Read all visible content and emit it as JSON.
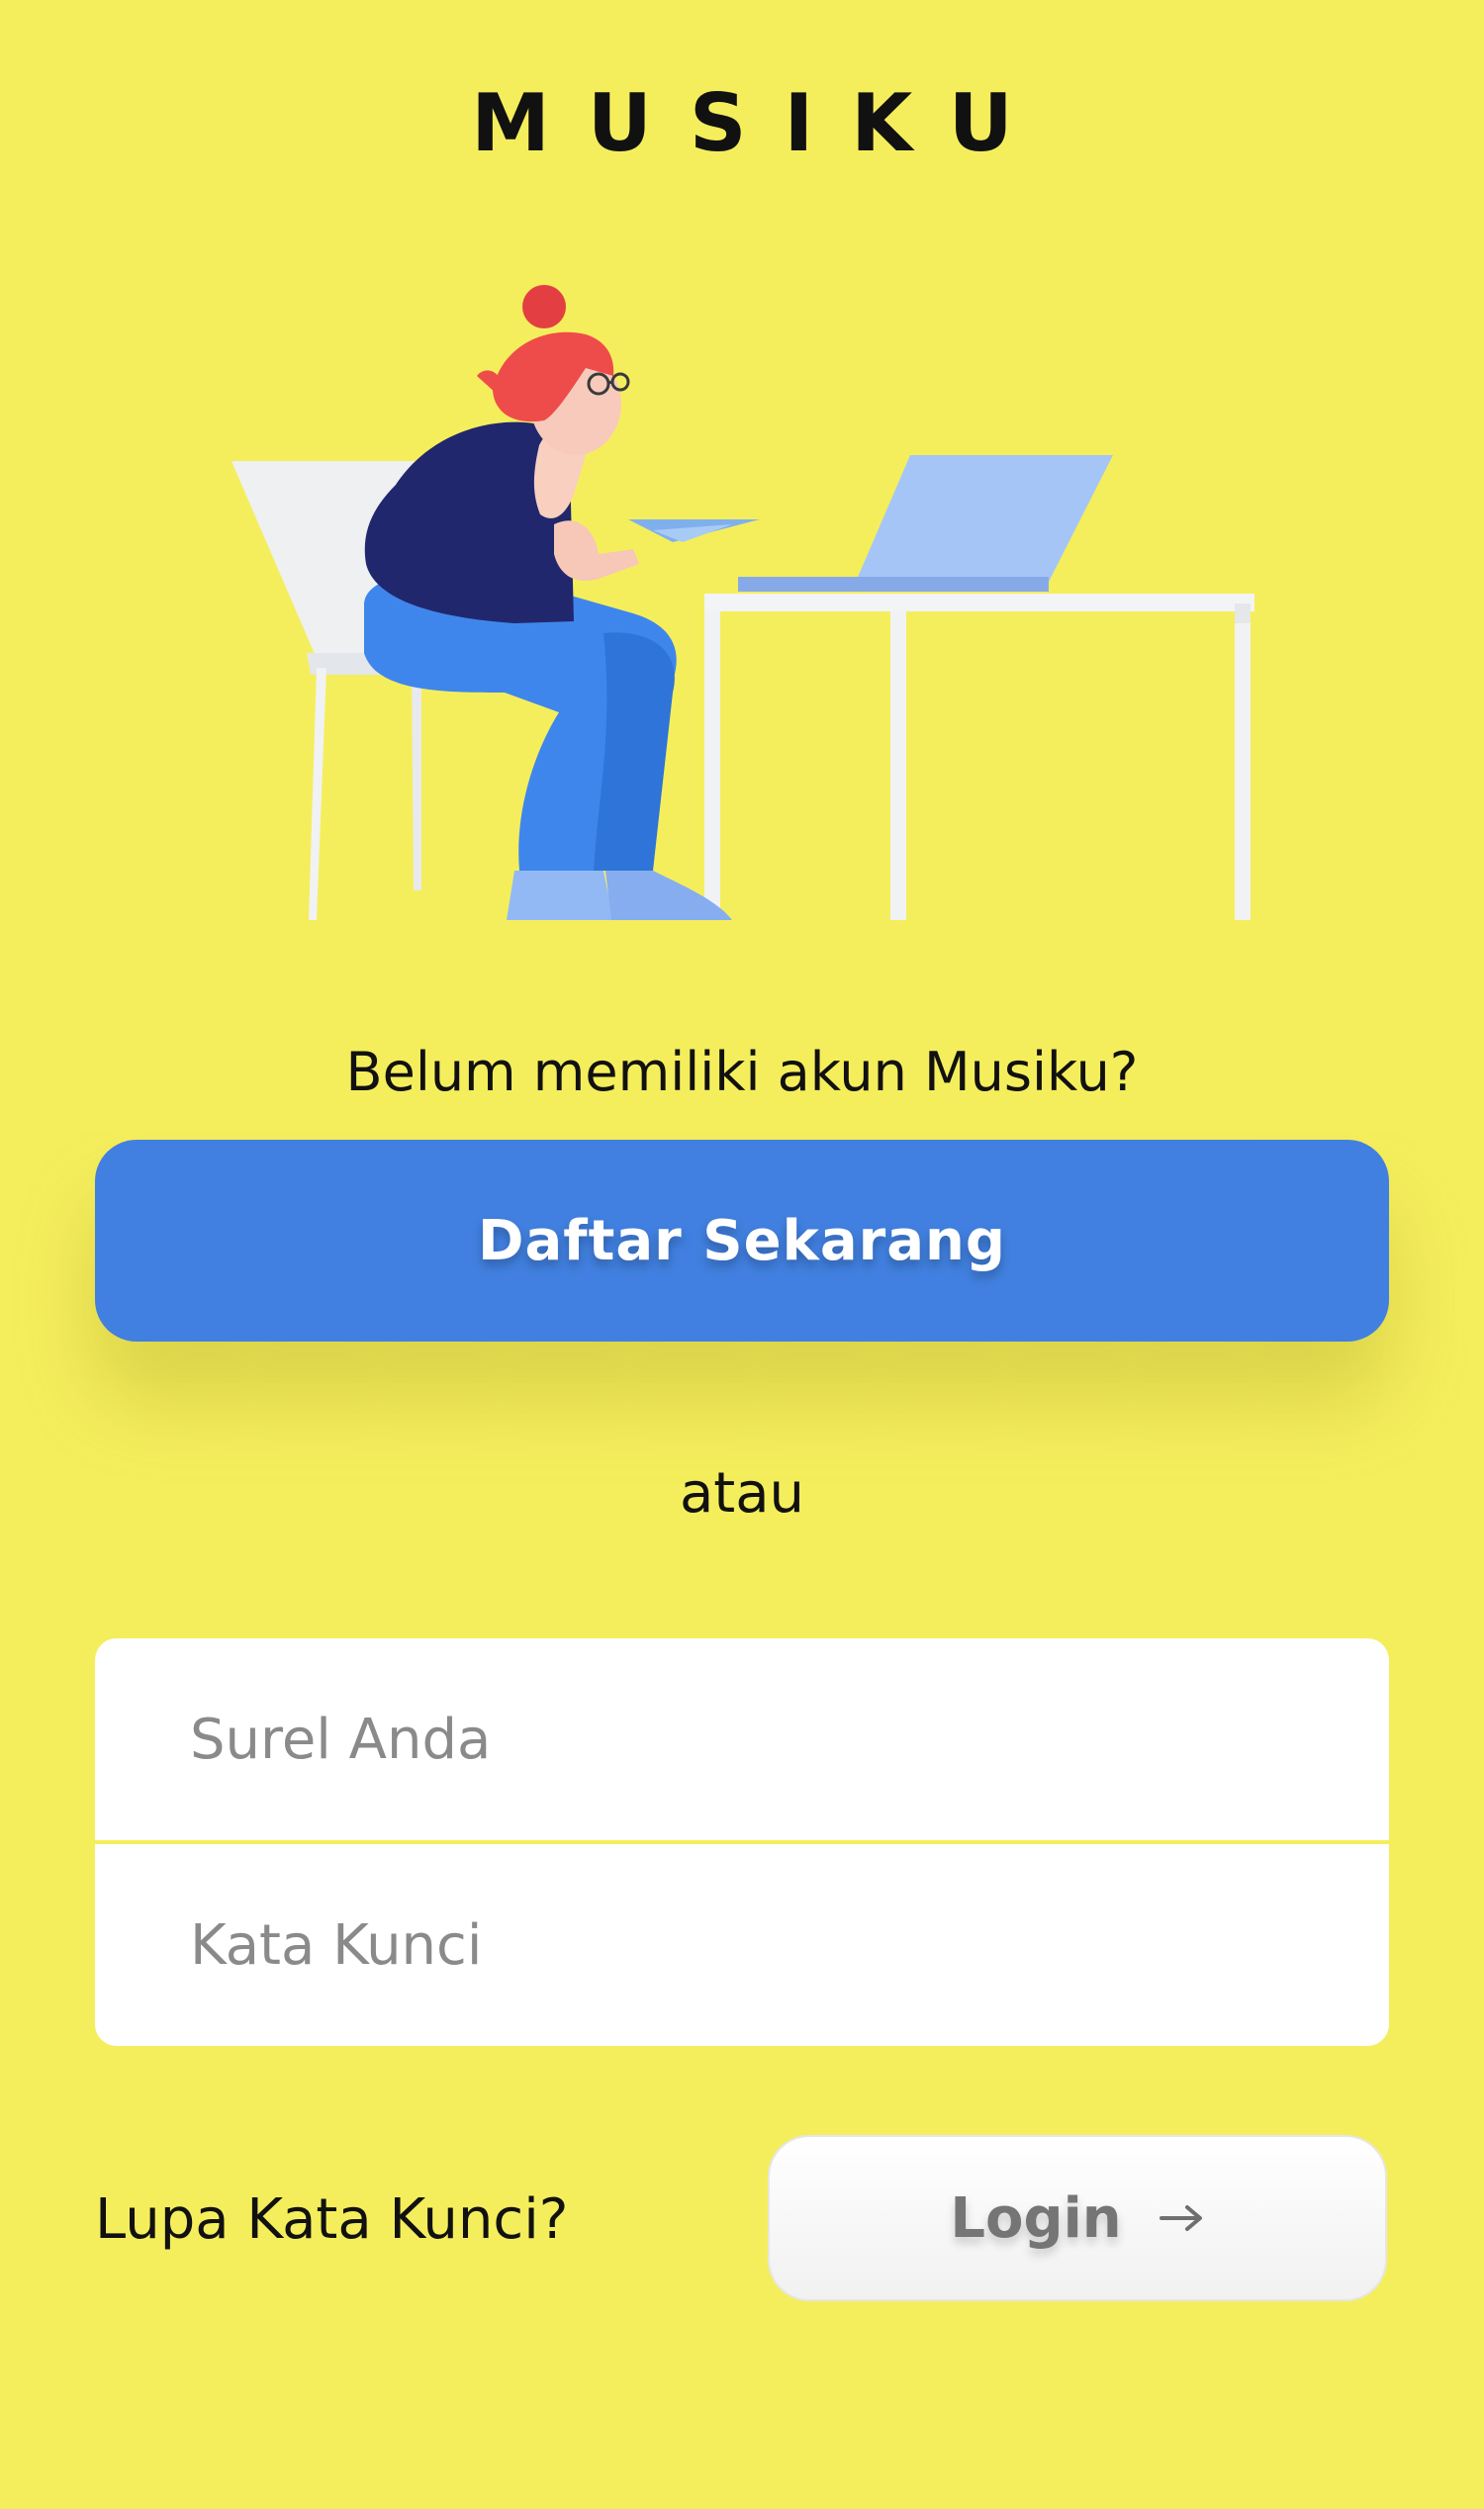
{
  "app": {
    "title": "MUSIKU"
  },
  "signup": {
    "prompt": "Belum memiliki akun Musiku?",
    "button_label": "Daftar Sekarang"
  },
  "divider": {
    "label": "atau"
  },
  "login_form": {
    "email_placeholder": "Surel Anda",
    "email_value": "",
    "password_placeholder": "Kata Kunci",
    "password_value": ""
  },
  "actions": {
    "forgot_label": "Lupa Kata Kunci?",
    "login_label": "Login",
    "login_icon": "arrow-right-icon"
  },
  "colors": {
    "background": "#F5EE5C",
    "primary_button": "#4180E0",
    "card": "#FFFFFF",
    "placeholder": "#8A8A8A"
  },
  "illustration": {
    "subject": "woman-at-desk-with-laptop-illustration"
  }
}
